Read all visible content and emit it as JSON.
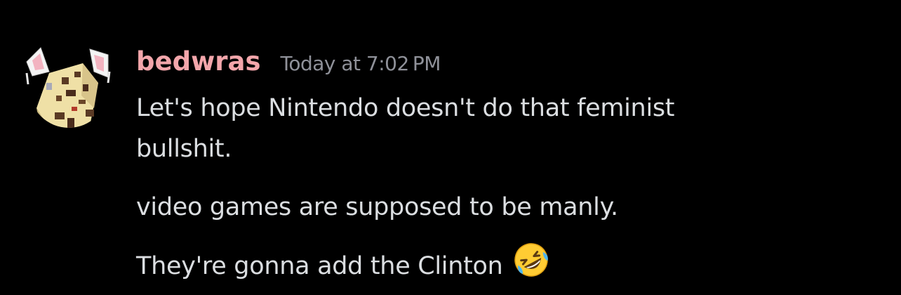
{
  "message_group": {
    "author": {
      "username": "bedwras",
      "username_color": "#f3a6ab",
      "avatar_icon": "cat-ear-block-character-avatar"
    },
    "timestamp": "Today at 7:02 PM",
    "timestamp_color": "#8f9199",
    "messages": [
      {
        "text_line1": "Let's hope Nintendo doesn't do that feminist",
        "text_line2": "bullshit."
      },
      {
        "text": "video games are supposed to be manly."
      },
      {
        "text": "They're gonna add the Clinton",
        "emoji": "rolling-on-the-floor-laughing-emoji"
      }
    ]
  },
  "colors": {
    "background": "#000000",
    "message_text": "#dbdee1"
  }
}
